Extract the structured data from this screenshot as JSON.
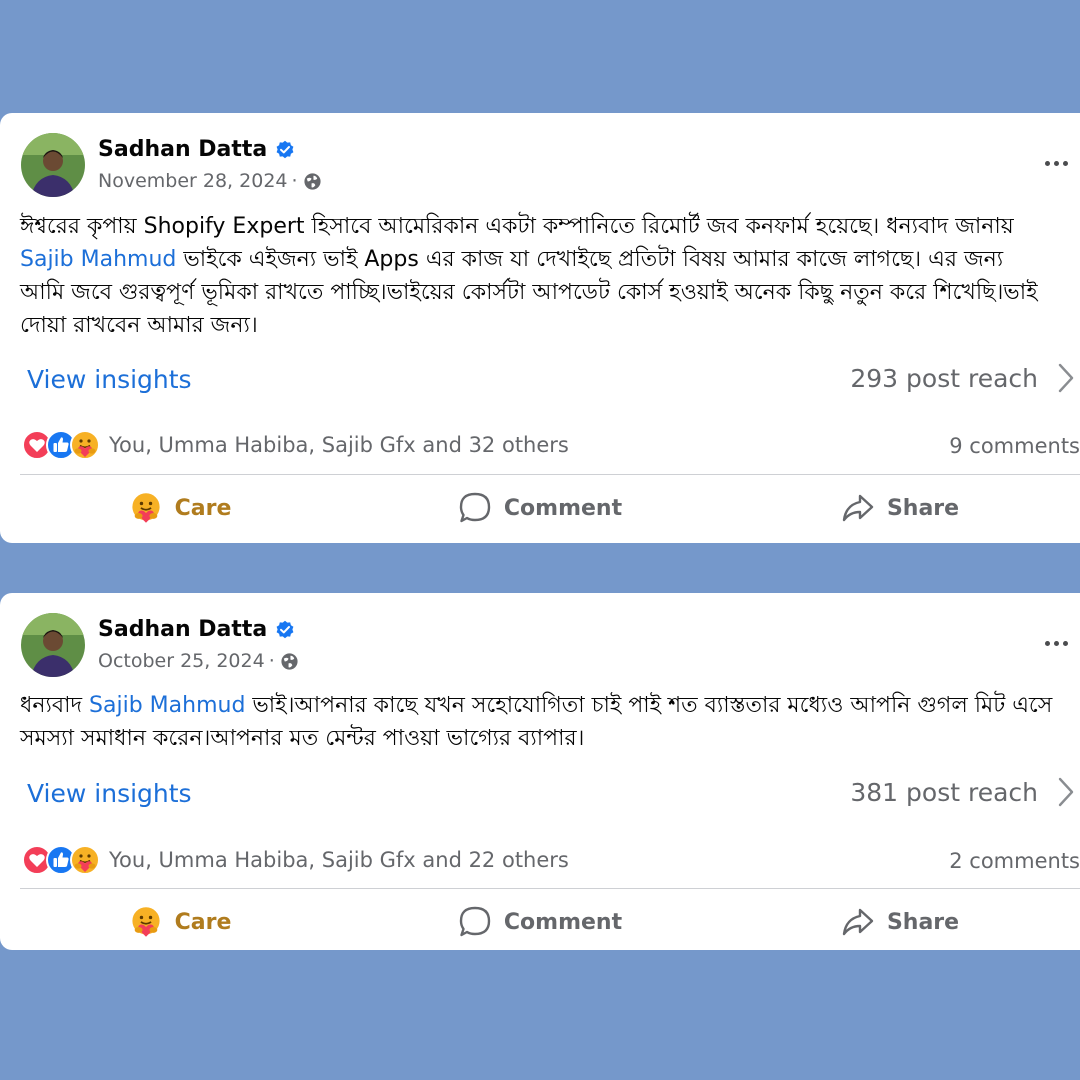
{
  "posts": [
    {
      "author": "Sadhan Datta",
      "date": "November 28, 2024",
      "date_separator": "·",
      "text_before": "ঈশ্বরের কৃপায় Shopify Expert হিসাবে আমেরিকান একটা কম্পানিতে রিমোর্ট জব কনফার্ম হয়েছে। ধন্যবাদ জানায় ",
      "mention": "Sajib Mahmud",
      "text_after": "  ভাইকে এইজন্য ভাই Apps এর কাজ যা দেখাইছে প্রতিটা বিষয় আমার কাজে লাগছে। এর জন্য আমি জবে গুরত্বপূর্ণ ভূমিকা রাখতে পাচ্ছি।ভাইয়ের কোর্সটা আপডেট কোর্স হওয়াই অনেক কিছু নতুন করে শিখেছি।ভাই দোয়া রাখবেন আমার জন্য।",
      "insights_label": "View insights",
      "reach": "293 post reach",
      "reactions_text": "You, Umma Habiba, Sajib Gfx and 32 others",
      "reaction_icons": [
        "love-icon",
        "like-icon",
        "care-icon"
      ],
      "comments": "9 comments",
      "actions": {
        "care": "Care",
        "comment": "Comment",
        "share": "Share"
      }
    },
    {
      "author": "Sadhan Datta",
      "date": "October 25, 2024",
      "date_separator": "·",
      "text_before": "ধন্যবাদ ",
      "mention": "Sajib Mahmud",
      "text_after": "  ভাই।আপনার কাছে যখন সহোযোগিতা চাই পাই শত ব্যাস্ততার মধ্যেও আপনি গুগল মিট এসে সমস্যা সমাধান করেন।আপনার মত মেন্টর পাওয়া ভাগ্যের ব্যাপার।",
      "insights_label": "View insights",
      "reach": "381 post reach",
      "reactions_text": "You, Umma Habiba, Sajib Gfx and 22 others",
      "reaction_icons": [
        "love-icon",
        "like-icon",
        "care-icon"
      ],
      "comments": "2 comments",
      "actions": {
        "care": "Care",
        "comment": "Comment",
        "share": "Share"
      }
    }
  ],
  "colors": {
    "background": "#7598cb",
    "link": "#1c6fd8",
    "secondary_text": "#65676b",
    "care_label": "#b07c1e",
    "verified": "#1877f2"
  }
}
